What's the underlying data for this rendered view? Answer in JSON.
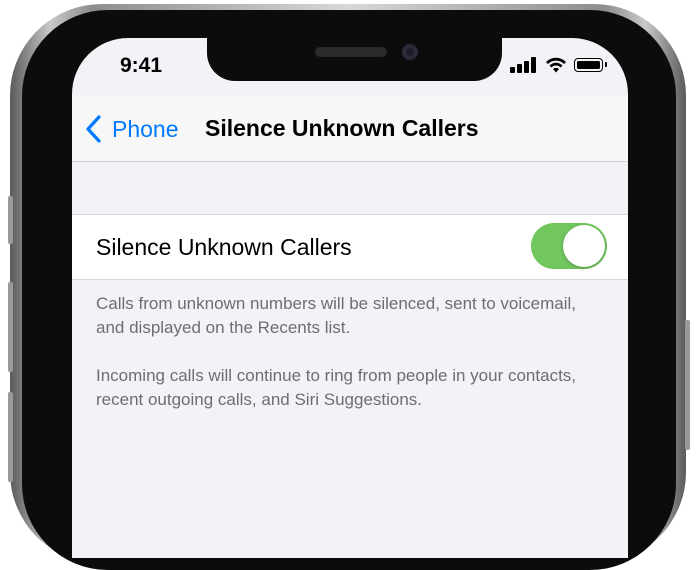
{
  "status_bar": {
    "time": "9:41",
    "icons": [
      "signal-icon",
      "wifi-icon",
      "battery-icon"
    ]
  },
  "nav_bar": {
    "back_label": "Phone",
    "back_icon": "chevron-left-icon",
    "title": "Silence Unknown Callers"
  },
  "setting": {
    "label": "Silence Unknown Callers",
    "toggle_on": true
  },
  "footer": {
    "paragraph_1": "Calls from unknown numbers will be silenced, sent to voicemail, and displayed on the Recents list.",
    "paragraph_2": "Incoming calls will continue to ring from people in your contacts, recent outgoing calls, and Siri Suggestions."
  },
  "colors": {
    "accent": "#007aff",
    "toggle_on": "#71c65e",
    "background": "#f2f2f7",
    "secondary_text": "#6d6d72"
  }
}
